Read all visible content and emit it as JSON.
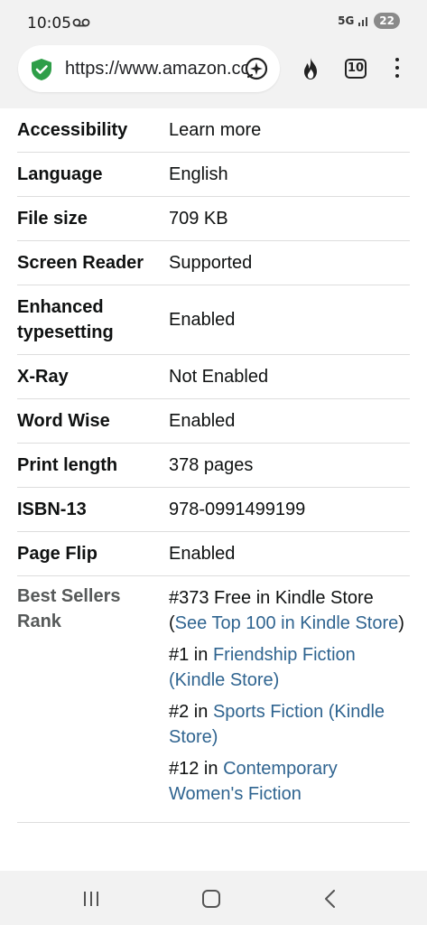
{
  "status": {
    "time": "10:05",
    "network": "5G",
    "battery": "22"
  },
  "browser": {
    "url": "https://www.amazon.com",
    "tab_count": "10"
  },
  "details": [
    {
      "label": "Accessibility",
      "value": "Learn more",
      "link": true
    },
    {
      "label": "Language",
      "value": "English",
      "link": false
    },
    {
      "label": "File size",
      "value": "709 KB",
      "link": false
    },
    {
      "label": "Screen Reader",
      "value": "Supported",
      "link": false
    },
    {
      "label": "Enhanced typesetting",
      "value": "Enabled",
      "link": true
    },
    {
      "label": "X-Ray",
      "value": "Not Enabled",
      "link": false
    },
    {
      "label": "Word Wise",
      "value": "Enabled",
      "link": true
    },
    {
      "label": "Print length",
      "value": "378 pages",
      "link": true
    },
    {
      "label": "ISBN-13",
      "value": "978-0991499199",
      "link": false
    },
    {
      "label": "Page Flip",
      "value": "Enabled",
      "link": true
    }
  ],
  "best_sellers": {
    "label": "Best Sellers Rank",
    "entries": [
      {
        "prefix": "#373 Free in Kindle Store",
        "paren_open": "(",
        "link": "See Top 100 in Kindle Store",
        "paren_close": ")"
      },
      {
        "prefix": "#1 in ",
        "link": "Friendship Fiction (Kindle Store)"
      },
      {
        "prefix": "#2 in ",
        "link": "Sports Fiction (Kindle Store)"
      },
      {
        "prefix": "#12 in ",
        "link": "Contemporary Women's Fiction"
      }
    ]
  },
  "colors": {
    "link": "#2f6490",
    "text": "#0f1111",
    "muted_label": "#565959",
    "shield": "#2e9e48"
  },
  "icons": [
    "voicemail-icon",
    "signal-icon",
    "shield-check-icon",
    "ai-sparkle-icon",
    "fire-icon",
    "tabs-icon",
    "more-vert-icon",
    "recent-apps-icon",
    "home-icon",
    "back-icon"
  ]
}
